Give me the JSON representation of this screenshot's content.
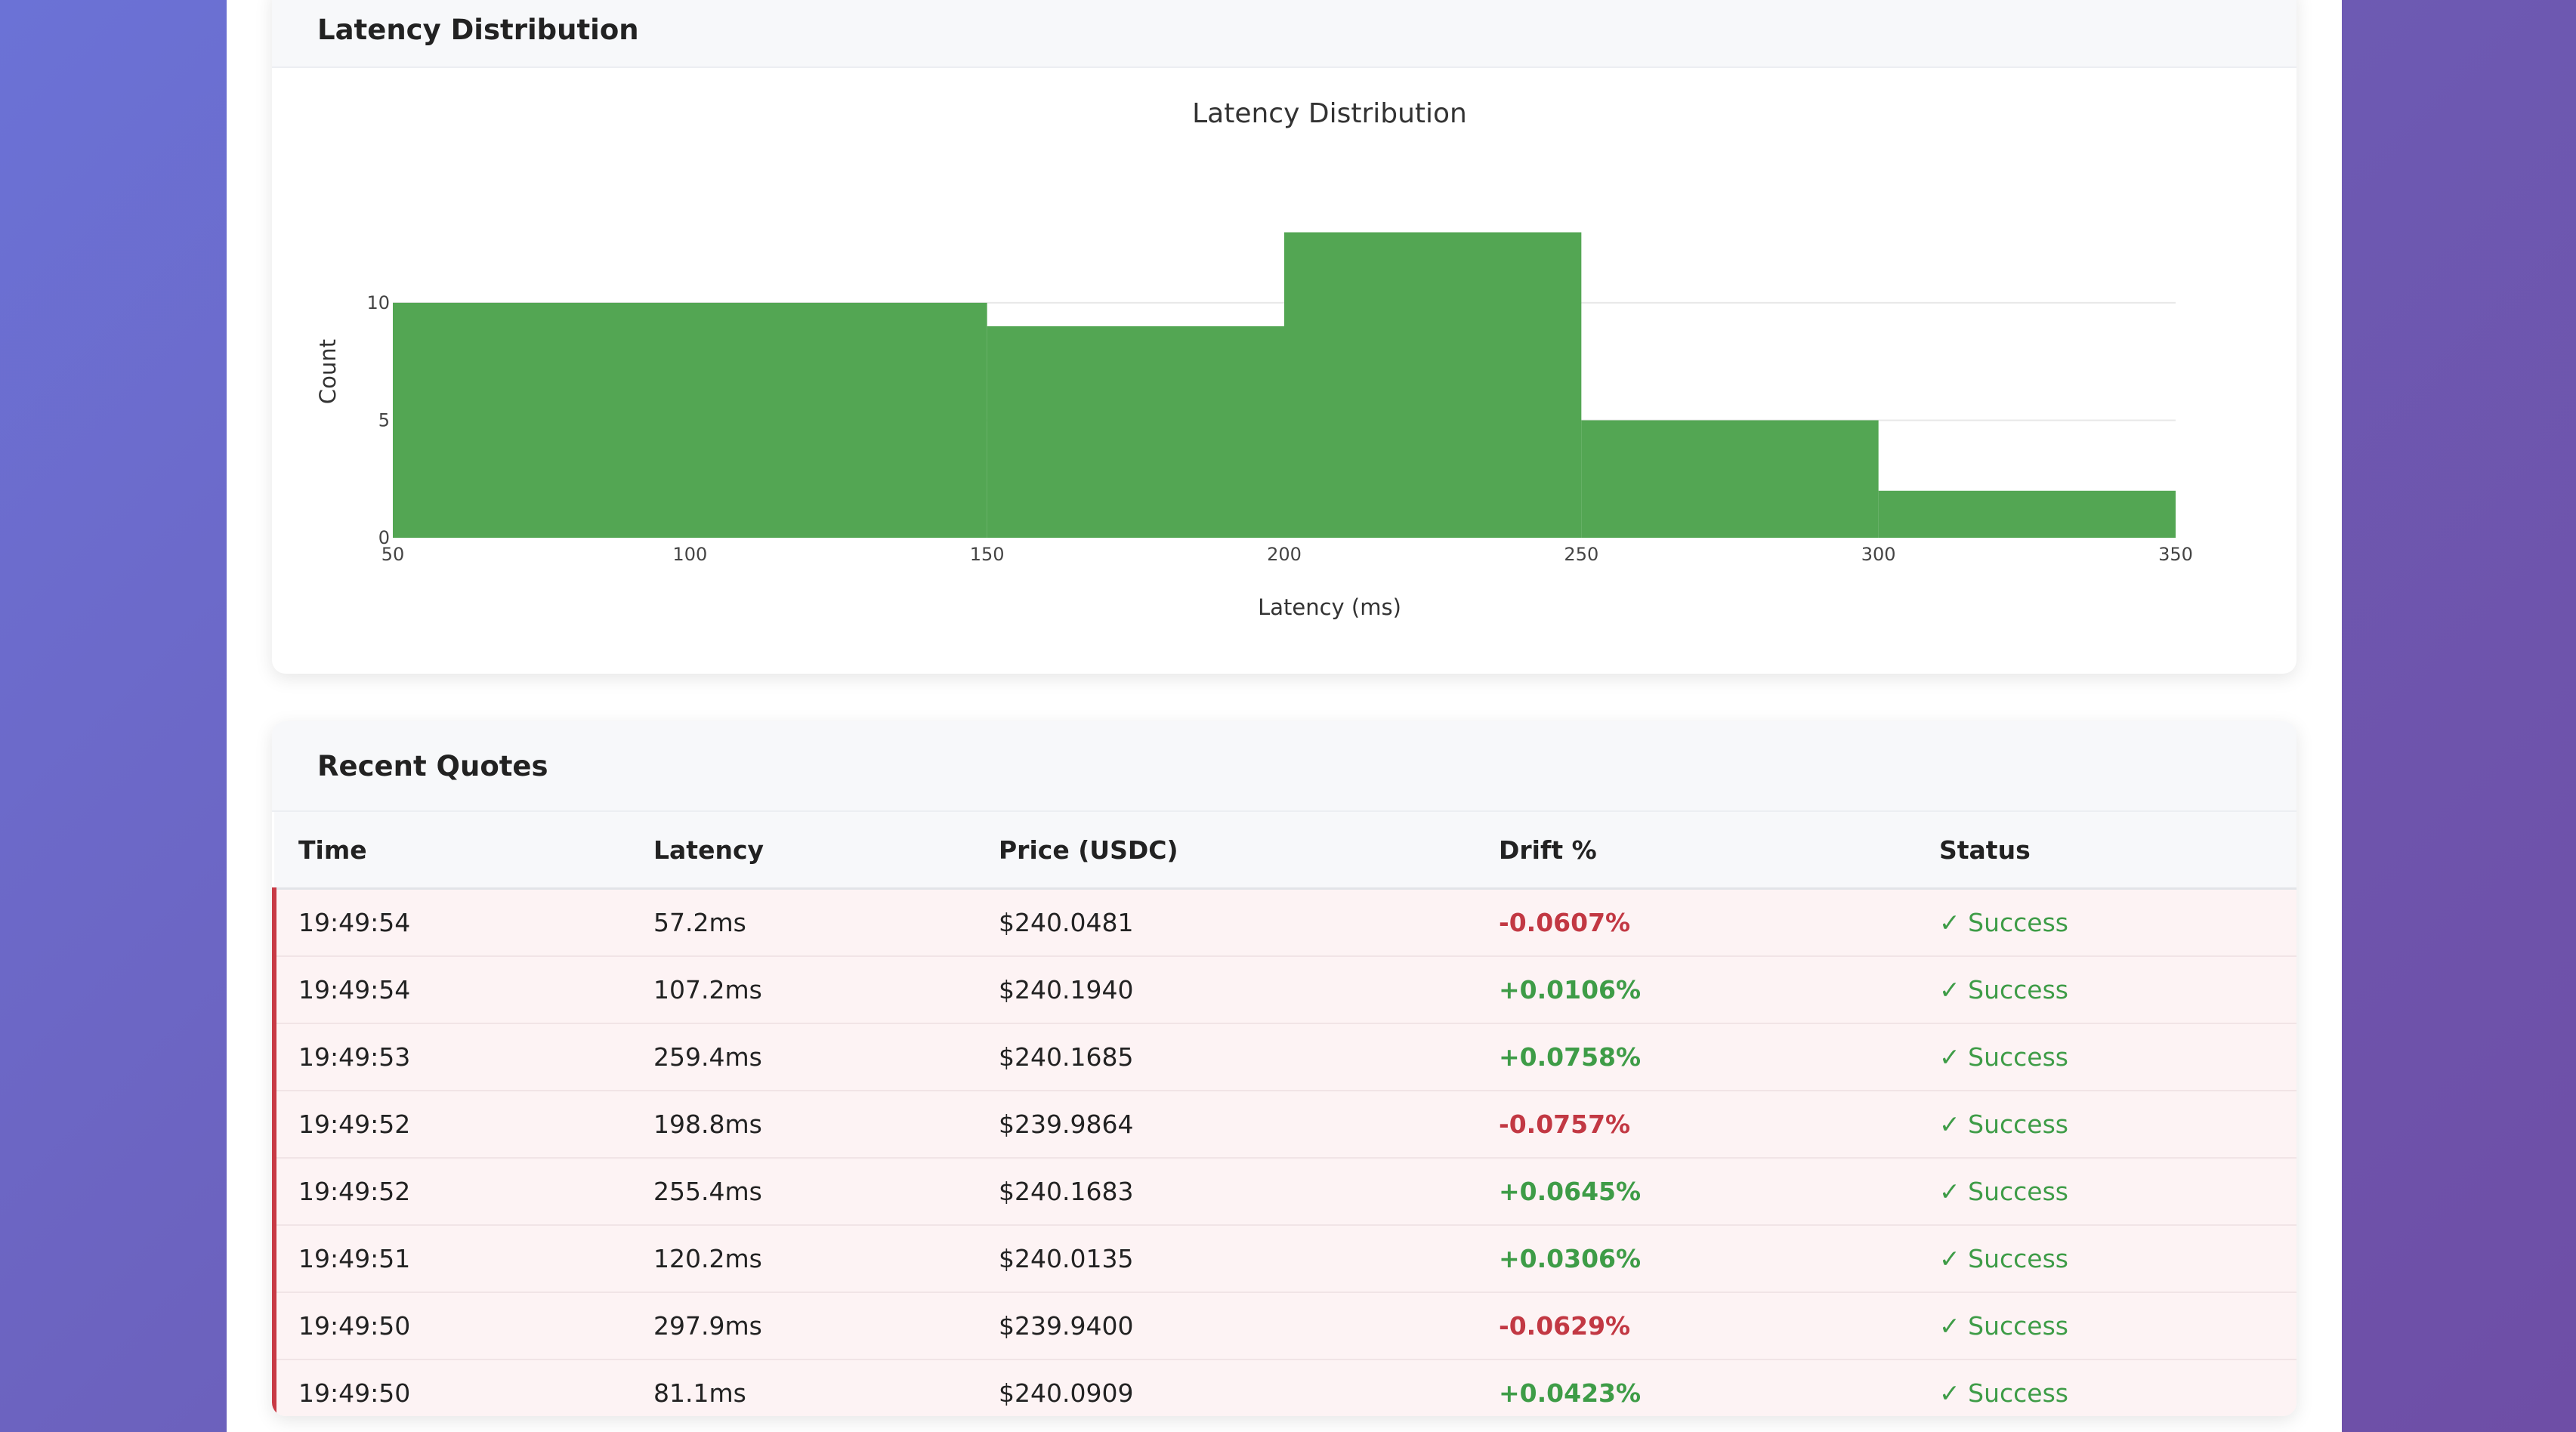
{
  "latency_panel": {
    "header_title": "Latency Distribution"
  },
  "chart_data": {
    "type": "bar",
    "subtype": "histogram",
    "title": "Latency Distribution",
    "xlabel": "Latency (ms)",
    "ylabel": "Count",
    "bins": [
      [
        50,
        150
      ],
      [
        150,
        200
      ],
      [
        200,
        250
      ],
      [
        250,
        300
      ],
      [
        300,
        350
      ]
    ],
    "values": [
      10,
      9,
      13,
      5,
      2
    ],
    "xlim": [
      50,
      350
    ],
    "ylim": [
      0,
      13.5
    ],
    "x_ticks": [
      50,
      100,
      150,
      200,
      250,
      300,
      350
    ],
    "y_ticks": [
      0,
      5,
      10
    ],
    "grid": true,
    "bar_color": "#53a653"
  },
  "quotes_panel": {
    "title": "Recent Quotes",
    "columns": [
      "Time",
      "Latency",
      "Price (USDC)",
      "Drift %",
      "Status"
    ],
    "rows": [
      {
        "time": "19:49:54",
        "latency": "57.2ms",
        "price": "$240.0481",
        "drift": "-0.0607%",
        "status": "✓ Success"
      },
      {
        "time": "19:49:54",
        "latency": "107.2ms",
        "price": "$240.1940",
        "drift": "+0.0106%",
        "status": "✓ Success"
      },
      {
        "time": "19:49:53",
        "latency": "259.4ms",
        "price": "$240.1685",
        "drift": "+0.0758%",
        "status": "✓ Success"
      },
      {
        "time": "19:49:52",
        "latency": "198.8ms",
        "price": "$239.9864",
        "drift": "-0.0757%",
        "status": "✓ Success"
      },
      {
        "time": "19:49:52",
        "latency": "255.4ms",
        "price": "$240.1683",
        "drift": "+0.0645%",
        "status": "✓ Success"
      },
      {
        "time": "19:49:51",
        "latency": "120.2ms",
        "price": "$240.0135",
        "drift": "+0.0306%",
        "status": "✓ Success"
      },
      {
        "time": "19:49:50",
        "latency": "297.9ms",
        "price": "$239.9400",
        "drift": "-0.0629%",
        "status": "✓ Success"
      },
      {
        "time": "19:49:50",
        "latency": "81.1ms",
        "price": "$240.0909",
        "drift": "+0.0423%",
        "status": "✓ Success"
      }
    ]
  },
  "colors": {
    "background_gradient_start": "#6b72d6",
    "background_gradient_end": "#6e4ea6",
    "positive": "#3e9c47",
    "negative": "#c23843",
    "row_accent": "#c83a45",
    "bar": "#53a653"
  }
}
